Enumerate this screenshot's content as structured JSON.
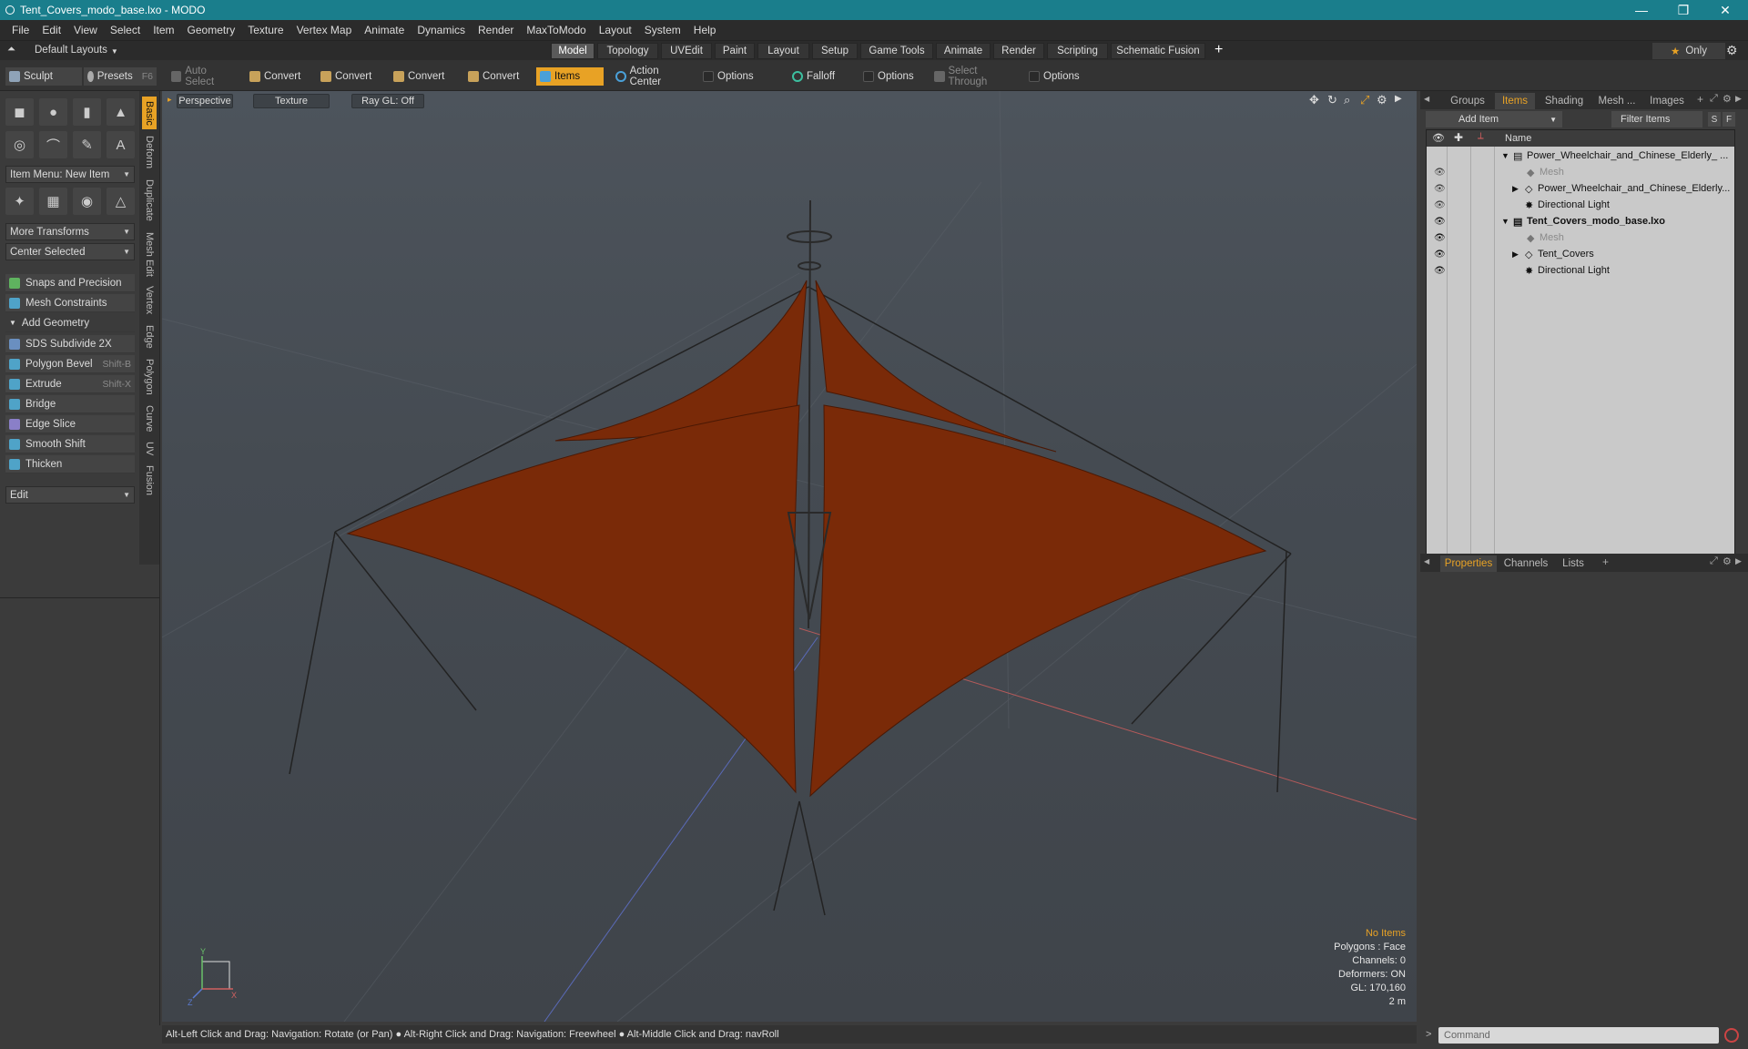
{
  "window": {
    "title": "Tent_Covers_modo_base.lxo - MODO",
    "minimize": "—",
    "restore": "❐",
    "close": "✕"
  },
  "menu": [
    "File",
    "Edit",
    "View",
    "Select",
    "Item",
    "Geometry",
    "Texture",
    "Vertex Map",
    "Animate",
    "Dynamics",
    "Render",
    "MaxToModo",
    "Layout",
    "System",
    "Help"
  ],
  "layout_selector": "Default Layouts",
  "tabs": [
    "Model",
    "Topology",
    "UVEdit",
    "Paint",
    "Layout",
    "Setup",
    "Game Tools",
    "Animate",
    "Render",
    "Scripting",
    "Schematic Fusion"
  ],
  "active_tab": "Model",
  "only_label": "Only",
  "toolbar": {
    "sculpt": "Sculpt",
    "presets": "Presets",
    "presets_key": "F6",
    "auto_select": "Auto Select",
    "convert1": "Convert",
    "convert2": "Convert",
    "convert3": "Convert",
    "convert4": "Convert",
    "items": "Items",
    "action_center": "Action Center",
    "options1": "Options",
    "falloff": "Falloff",
    "options2": "Options",
    "select_through": "Select Through",
    "options3": "Options"
  },
  "left_panel": {
    "vtabs": [
      "Basic",
      "Deform",
      "Duplicate",
      "Mesh Edit",
      "Vertex",
      "Edge",
      "Polygon",
      "Curve",
      "UV",
      "Fusion"
    ],
    "item_menu": "Item Menu: New Item",
    "more_transforms": "More Transforms",
    "center_selected": "Center Selected",
    "snaps": "Snaps and Precision",
    "mesh_constraints": "Mesh Constraints",
    "add_geometry": "Add Geometry",
    "tools": [
      {
        "label": "SDS Subdivide 2X",
        "shortcut": "",
        "color": "#6a8fc0"
      },
      {
        "label": "Polygon Bevel",
        "shortcut": "Shift-B",
        "color": "#4fa3c8"
      },
      {
        "label": "Extrude",
        "shortcut": "Shift-X",
        "color": "#4fa3c8"
      },
      {
        "label": "Bridge",
        "shortcut": "",
        "color": "#4fa3c8"
      },
      {
        "label": "Edge Slice",
        "shortcut": "",
        "color": "#8a7fc8"
      },
      {
        "label": "Smooth Shift",
        "shortcut": "",
        "color": "#4fa3c8"
      },
      {
        "label": "Thicken",
        "shortcut": "",
        "color": "#4fa3c8"
      }
    ],
    "edit": "Edit"
  },
  "viewport": {
    "perspective": "Perspective",
    "texture": "Texture",
    "raygl": "Ray GL: Off",
    "info": {
      "items": "No Items",
      "polygons": "Polygons : Face",
      "channels": "Channels: 0",
      "deformers": "Deformers: ON",
      "gl": "GL: 170,160",
      "scale": "2 m"
    },
    "tent_color": "#7a2a08",
    "axis_labels": {
      "y": "Y",
      "z": "Z",
      "x": "X"
    }
  },
  "status": "Alt-Left Click and Drag: Navigation: Rotate (or Pan) ● Alt-Right Click and Drag: Navigation: Freewheel ● Alt-Middle Click and Drag: navRoll",
  "right_panel": {
    "tabs": [
      "Groups",
      "Items",
      "Shading",
      "Mesh ...",
      "Images"
    ],
    "active_tab": "Items",
    "add_item": "Add Item",
    "filter_items": "Filter Items",
    "s_btn": "S",
    "f_btn": "F",
    "name_col": "Name",
    "rows": [
      {
        "label": "Power_Wheelchair_and_Chinese_Elderly_ ...",
        "indent": 1,
        "expand": "▼",
        "style": "normal"
      },
      {
        "label": "Mesh",
        "indent": 2,
        "expand": "",
        "style": "grey"
      },
      {
        "label": "Power_Wheelchair_and_Chinese_Elderly...",
        "indent": 2,
        "expand": "▶",
        "style": "normal"
      },
      {
        "label": "Directional Light",
        "indent": 2,
        "expand": "",
        "style": "normal"
      },
      {
        "label": "Tent_Covers_modo_base.lxo",
        "indent": 1,
        "expand": "▼",
        "style": "bold"
      },
      {
        "label": "Mesh",
        "indent": 2,
        "expand": "",
        "style": "grey"
      },
      {
        "label": "Tent_Covers",
        "indent": 2,
        "expand": "▶",
        "style": "normal"
      },
      {
        "label": "Directional Light",
        "indent": 2,
        "expand": "",
        "style": "normal"
      }
    ],
    "bottom_tabs": [
      "Properties",
      "Channels",
      "Lists"
    ],
    "bottom_active": "Properties",
    "command_placeholder": "Command"
  }
}
